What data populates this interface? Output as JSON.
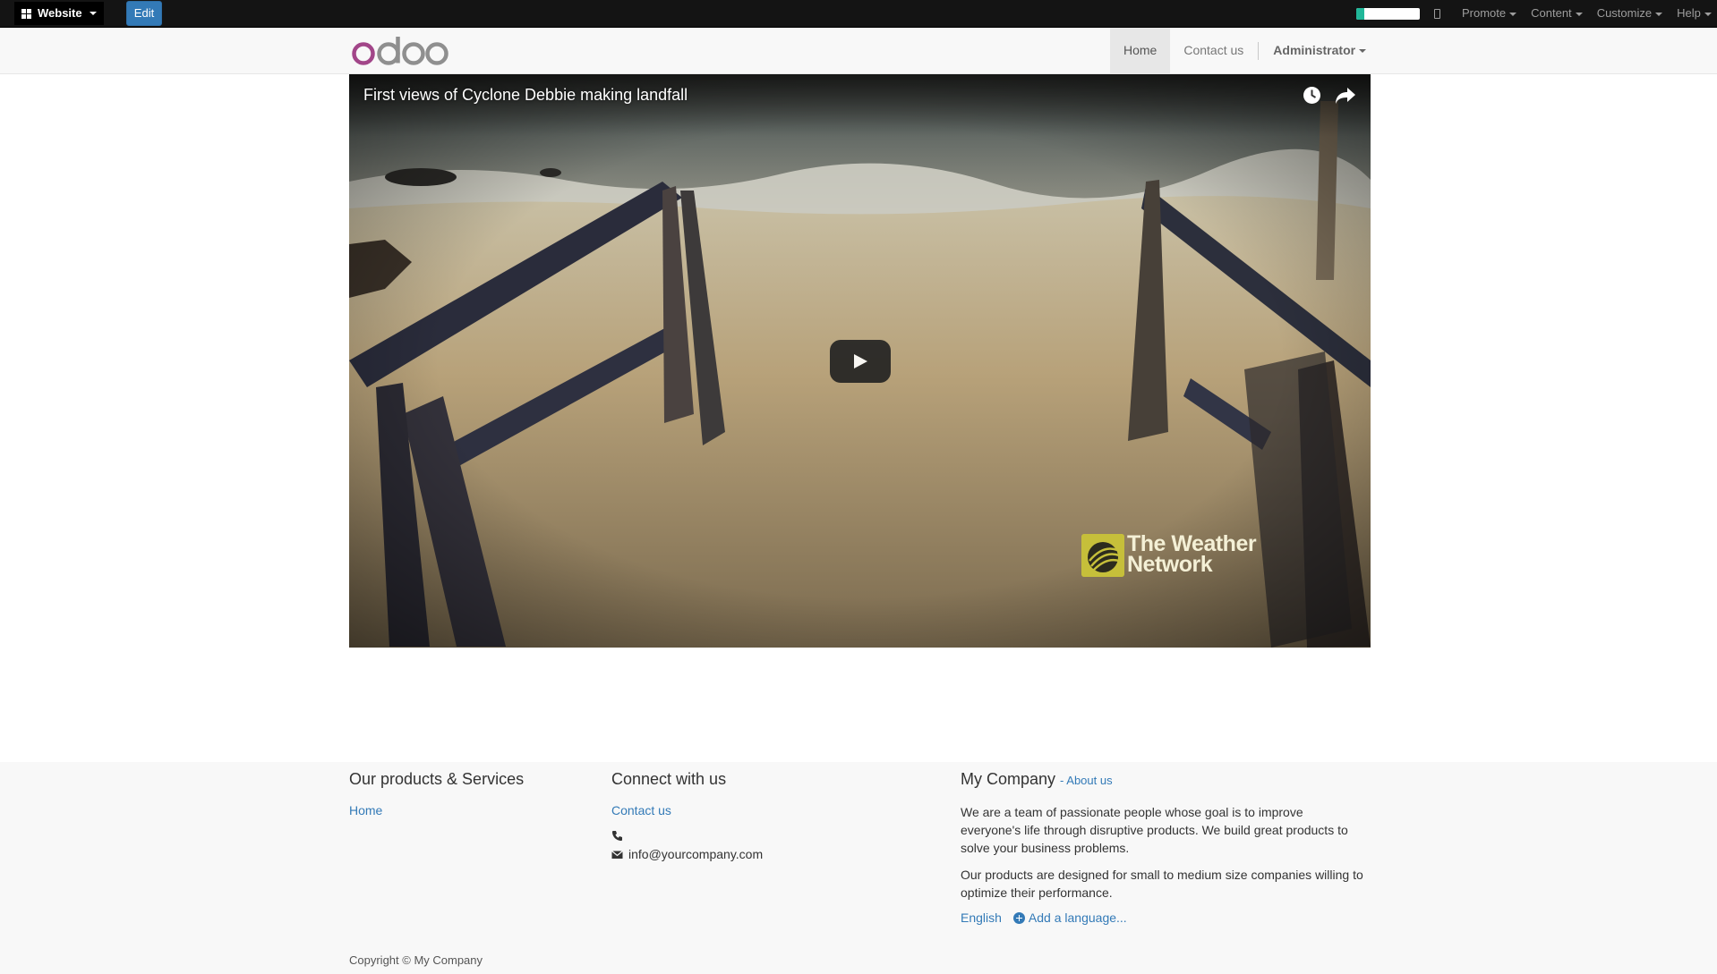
{
  "admin_bar": {
    "app_label": "Website",
    "edit_label": "Edit",
    "menus": [
      "Promote",
      "Content",
      "Customize",
      "Help"
    ],
    "progress_percent": 12,
    "colors": {
      "bar": "#141414",
      "edit": "#337ab7",
      "progress": "#21b799"
    }
  },
  "header": {
    "logo_text": "odoo",
    "nav": {
      "home": "Home",
      "contact": "Contact us",
      "user": "Administrator"
    }
  },
  "video": {
    "title": "First views of Cyclone Debbie making landfall",
    "watermark_line1": "The Weather",
    "watermark_line2": "Network",
    "icons": [
      "clock-icon",
      "share-icon",
      "play-icon"
    ]
  },
  "footer": {
    "products": {
      "heading": "Our products & Services",
      "home_link": "Home"
    },
    "connect": {
      "heading": "Connect with us",
      "contact_link": "Contact us",
      "phone": "",
      "email": "info@yourcompany.com"
    },
    "company": {
      "heading": "My Company",
      "about_link": "- About us",
      "para1": "We are a team of passionate people whose goal is to improve everyone's life through disruptive products. We build great products to solve your business problems.",
      "para2": "Our products are designed for small to medium size companies willing to optimize their performance.",
      "lang_current": "English",
      "add_language": "Add a language..."
    },
    "copyright": "Copyright © My Company"
  }
}
